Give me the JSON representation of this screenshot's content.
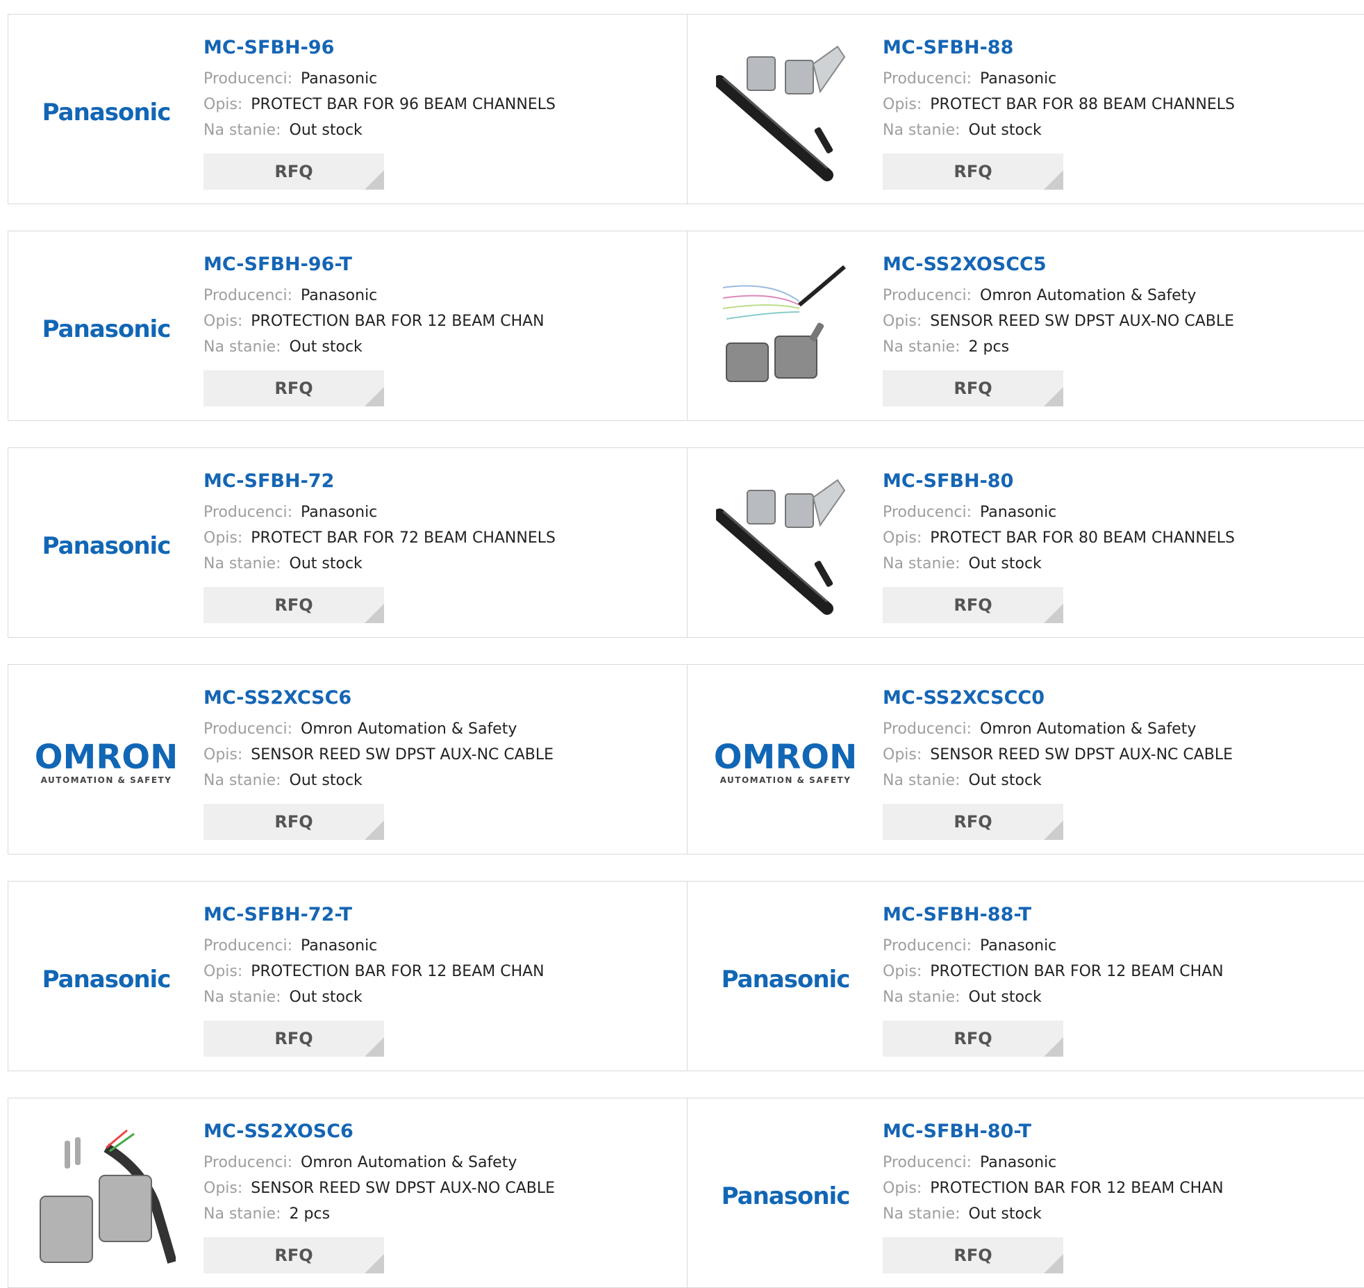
{
  "labels": {
    "manufacturer": "Producenci:",
    "description": "Opis:",
    "stock": "Na stanie:",
    "rfq": "RFQ"
  },
  "colors": {
    "title": "#1565b4",
    "logo_blue": "#1166b5",
    "label_grey": "#9e9e9e",
    "button_bg": "#efefef"
  },
  "products": [
    {
      "title": "MC-SFBH-96",
      "manufacturer": "Panasonic",
      "description": "PROTECT BAR FOR 96 BEAM CHANNELS",
      "stock": "Out stock",
      "image": "panasonic-logo",
      "logo_text": "Panasonic"
    },
    {
      "title": "MC-SFBH-88",
      "manufacturer": "Panasonic",
      "description": "PROTECT BAR FOR 88 BEAM CHANNELS",
      "stock": "Out stock",
      "image": "protect-bar-photo"
    },
    {
      "title": "MC-SFBH-96-T",
      "manufacturer": "Panasonic",
      "description": "PROTECTION BAR FOR 12 BEAM CHAN",
      "stock": "Out stock",
      "image": "panasonic-logo",
      "logo_text": "Panasonic"
    },
    {
      "title": "MC-SS2XOSCC5",
      "manufacturer": "Omron Automation & Safety",
      "description": "SENSOR REED SW DPST AUX-NO CABLE",
      "stock": "2 pcs",
      "image": "reed-switch-cable-photo"
    },
    {
      "title": "MC-SFBH-72",
      "manufacturer": "Panasonic",
      "description": "PROTECT BAR FOR 72 BEAM CHANNELS",
      "stock": "Out stock",
      "image": "panasonic-logo",
      "logo_text": "Panasonic"
    },
    {
      "title": "MC-SFBH-80",
      "manufacturer": "Panasonic",
      "description": "PROTECT BAR FOR 80 BEAM CHANNELS",
      "stock": "Out stock",
      "image": "protect-bar-photo"
    },
    {
      "title": "MC-SS2XCSC6",
      "manufacturer": "Omron Automation & Safety",
      "description": "SENSOR REED SW DPST AUX-NC CABLE",
      "stock": "Out stock",
      "image": "omron-logo",
      "logo_text": "OMRON",
      "logo_sub": "AUTOMATION & SAFETY"
    },
    {
      "title": "MC-SS2XCSCC0",
      "manufacturer": "Omron Automation & Safety",
      "description": "SENSOR REED SW DPST AUX-NC CABLE",
      "stock": "Out stock",
      "image": "omron-logo",
      "logo_text": "OMRON",
      "logo_sub": "AUTOMATION & SAFETY"
    },
    {
      "title": "MC-SFBH-72-T",
      "manufacturer": "Panasonic",
      "description": "PROTECTION BAR FOR 12 BEAM CHAN",
      "stock": "Out stock",
      "image": "panasonic-logo",
      "logo_text": "Panasonic"
    },
    {
      "title": "MC-SFBH-88-T",
      "manufacturer": "Panasonic",
      "description": "PROTECTION BAR FOR 12 BEAM CHAN",
      "stock": "Out stock",
      "image": "panasonic-logo",
      "logo_text": "Panasonic"
    },
    {
      "title": "MC-SS2XOSC6",
      "manufacturer": "Omron Automation & Safety",
      "description": "SENSOR REED SW DPST AUX-NO CABLE",
      "stock": "2 pcs",
      "image": "reed-switch-photo"
    },
    {
      "title": "MC-SFBH-80-T",
      "manufacturer": "Panasonic",
      "description": "PROTECTION BAR FOR 12 BEAM CHAN",
      "stock": "Out stock",
      "image": "panasonic-logo",
      "logo_text": "Panasonic"
    }
  ]
}
